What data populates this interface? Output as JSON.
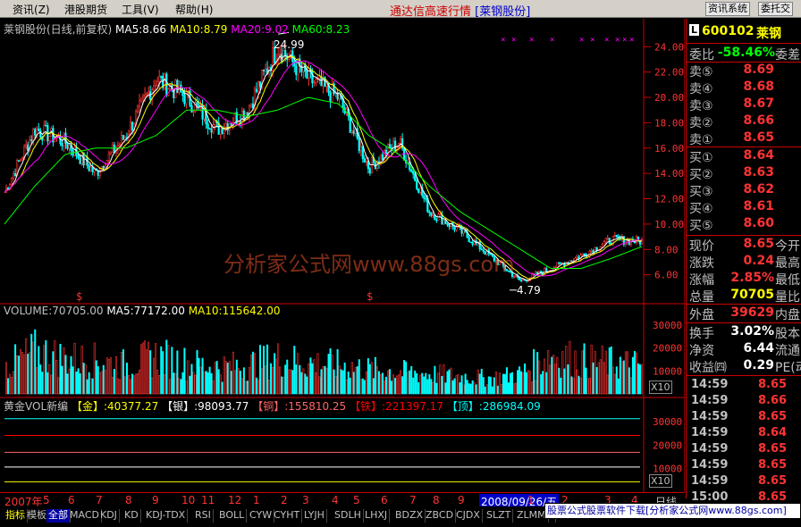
{
  "menu": {
    "items": [
      "资讯",
      "港股期货",
      "工具",
      "帮助"
    ],
    "hotkeys": [
      "(Z)",
      "",
      "(V)",
      "(H)"
    ]
  },
  "app_title": {
    "prefix": "通达信高速行情",
    "stock": "[莱钢股份]"
  },
  "toolbar": {
    "info_system": "资讯系统",
    "commission": "委托交"
  },
  "chart_header": {
    "name": "莱钢股份(日线,前复权)",
    "ma5": "MA5:8.66",
    "ma10": "MA10:8.79",
    "ma20": "MA20:9.02",
    "ma60": "MA60:8.23"
  },
  "annotations": {
    "high": "24.99",
    "low": "4.79"
  },
  "watermark": "分析家公式网www.88gs.com",
  "volume_header": {
    "vol": "VOLUME:70705.00",
    "ma5": "MA5:77172.00",
    "ma10": "MA10:115642.00"
  },
  "gold_header": {
    "title": "黄金VOL新编",
    "gold": "【金】:40377.27",
    "silver": "【银】:98093.77",
    "copper": "【铜】:155810.25",
    "iron": "【铁】:221397.17",
    "top": "【顶】:286984.09"
  },
  "x10": "X10",
  "price_axis": [
    "24.00",
    "22.00",
    "20.00",
    "18.00",
    "16.00",
    "14.00",
    "12.00",
    "10.00",
    "8.00",
    "6.00"
  ],
  "volume_axis": [
    "30000",
    "20000",
    "10000"
  ],
  "gold_axis": [
    "30000",
    "20000",
    "10000"
  ],
  "dates": {
    "labels": [
      "2007年",
      "5",
      "6",
      "7",
      "8",
      "9",
      "10",
      "11",
      "12",
      "1",
      "2",
      "3",
      "4",
      "5",
      "6",
      "7",
      "8",
      "9",
      "1",
      "2",
      "3",
      "4"
    ],
    "cursor": "2008/09/26/五",
    "period": "日线"
  },
  "quote": {
    "code": "600102",
    "name": "莱钢",
    "weibi_label": "委比",
    "weibi_value": "-58.46%",
    "weicha_label": "委差",
    "asks": [
      {
        "label": "卖⑤",
        "price": "8.69"
      },
      {
        "label": "卖④",
        "price": "8.68"
      },
      {
        "label": "卖③",
        "price": "8.67"
      },
      {
        "label": "卖②",
        "price": "8.66"
      },
      {
        "label": "卖①",
        "price": "8.65"
      }
    ],
    "bids": [
      {
        "label": "买①",
        "price": "8.64"
      },
      {
        "label": "买②",
        "price": "8.63"
      },
      {
        "label": "买③",
        "price": "8.62"
      },
      {
        "label": "买④",
        "price": "8.61"
      },
      {
        "label": "买⑤",
        "price": "8.60"
      }
    ],
    "stats": [
      {
        "label": "现价",
        "value": "8.65",
        "tail": "今开",
        "color": "#ff3333"
      },
      {
        "label": "涨跌",
        "value": "0.24",
        "tail": "最高",
        "color": "#ff3333"
      },
      {
        "label": "涨幅",
        "value": "2.85%",
        "tail": "最低",
        "color": "#ff3333"
      },
      {
        "label": "总量",
        "value": "70705",
        "tail": "量比",
        "color": "#ffff00"
      }
    ],
    "trade": [
      {
        "label": "外盘",
        "value": "39629",
        "tail": "内盘",
        "color": "#ff3333"
      }
    ],
    "fin": [
      {
        "label": "换手",
        "value": "3.02%",
        "tail": "股本",
        "color": "#ffffff"
      },
      {
        "label": "净资",
        "value": "6.44",
        "tail": "流通",
        "color": "#ffffff"
      },
      {
        "label": "收益㈣",
        "value": "0.29",
        "tail": "PE(动",
        "color": "#ffffff"
      }
    ],
    "ticks": [
      {
        "time": "14:59",
        "price": "8.65"
      },
      {
        "time": "14:59",
        "price": "8.66"
      },
      {
        "time": "14:59",
        "price": "8.65"
      },
      {
        "time": "14:59",
        "price": "8.64"
      },
      {
        "time": "14:59",
        "price": "8.65"
      },
      {
        "time": "14:59",
        "price": "8.65"
      },
      {
        "time": "14:59",
        "price": "8.65"
      },
      {
        "time": "15:00",
        "price": "8.65"
      }
    ]
  },
  "bottom_tabs": [
    "指标",
    "模板",
    "全部",
    "MACD",
    "KDJ",
    "KD",
    "KDJ-TDX",
    "RSI",
    "BOLL",
    "CYW",
    "CYHT",
    "LYJH",
    "SDLH",
    "LHXJ",
    "BDZX",
    "ZBCD",
    "CJDX",
    "SLZT",
    "ZLMM",
    "S"
  ],
  "banner": "股票公式股票软件下载[分析家公式网www.88gs.com]",
  "colors": {
    "up": "#ff3333",
    "down": "#00ffff",
    "ma5": "#ffffff",
    "ma10": "#ffff00",
    "ma20": "#ff00ff",
    "ma60": "#00ff00"
  },
  "chart_data": {
    "type": "line",
    "title": "莱钢股份(日线,前复权)",
    "x": [
      "2007-04",
      "2007-05",
      "2007-06",
      "2007-07",
      "2007-08",
      "2007-09",
      "2007-10",
      "2007-11",
      "2007-12",
      "2008-01",
      "2008-02",
      "2008-03",
      "2008-04",
      "2008-05",
      "2008-06",
      "2008-07",
      "2008-08",
      "2008-09",
      "2009-01",
      "2009-02",
      "2009-03",
      "2009-04"
    ],
    "series": [
      {
        "name": "close",
        "values": [
          12.5,
          17.5,
          16.5,
          14.0,
          17.0,
          21.5,
          20.0,
          17.5,
          19.0,
          24.0,
          21.5,
          20.0,
          14.5,
          16.5,
          11.0,
          9.5,
          7.5,
          5.5,
          6.5,
          7.5,
          8.8,
          8.65
        ]
      },
      {
        "name": "MA60",
        "values": [
          10.0,
          13.0,
          15.5,
          16.0,
          16.0,
          17.0,
          19.0,
          19.0,
          18.5,
          19.0,
          20.0,
          19.5,
          17.0,
          15.5,
          13.0,
          11.0,
          9.5,
          8.0,
          6.5,
          6.5,
          7.3,
          8.23
        ]
      }
    ],
    "ylim": [
      4.79,
      24.99
    ],
    "annotations": [
      {
        "label": "24.99",
        "x": "2008-01"
      },
      {
        "label": "4.79",
        "x": "2008-10"
      }
    ],
    "volume": {
      "name": "VOLUME",
      "values": [
        12000,
        19000,
        16000,
        15000,
        13000,
        17000,
        14000,
        12000,
        13000,
        16000,
        14000,
        13000,
        11000,
        10000,
        9000,
        8000,
        7000,
        9000,
        18000,
        15000,
        14000,
        13000
      ],
      "ylim": [
        0,
        35000
      ]
    }
  }
}
